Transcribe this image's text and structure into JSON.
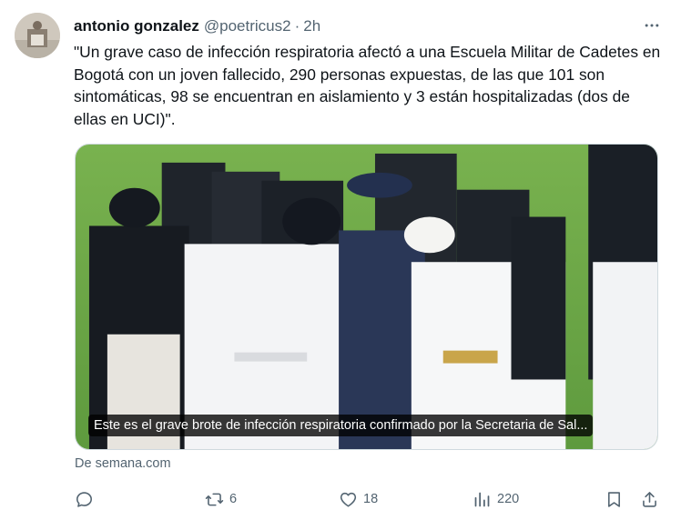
{
  "tweet": {
    "author_name": "antonio gonzalez",
    "author_handle": "@poetricus2",
    "separator": "·",
    "time": "2h",
    "text": "\"Un grave caso de infección respiratoria afectó a una Escuela Militar de Cadetes en Bogotá con un joven fallecido, 290 personas expuestas, de las que 101 son sintomáticas, 98 se encuentran en aislamiento y 3 están hospitalizadas (dos de ellas en UCI)\".",
    "media": {
      "caption": "Este es el grave brote de infección respiratoria confirmado por la Secretaria de Sal..."
    },
    "source": "De semana.com"
  },
  "actions": {
    "reply": {
      "icon": "reply-icon",
      "count": ""
    },
    "retweet": {
      "icon": "retweet-icon",
      "count": "6"
    },
    "like": {
      "icon": "heart-icon",
      "count": "18"
    },
    "views": {
      "icon": "views-icon",
      "count": "220"
    },
    "bookmark": {
      "icon": "bookmark-icon"
    },
    "share": {
      "icon": "share-icon"
    }
  },
  "colors": {
    "text_primary": "#0f1419",
    "text_secondary": "#536471",
    "border": "#cfd9de",
    "field_green": "#6fa848"
  }
}
